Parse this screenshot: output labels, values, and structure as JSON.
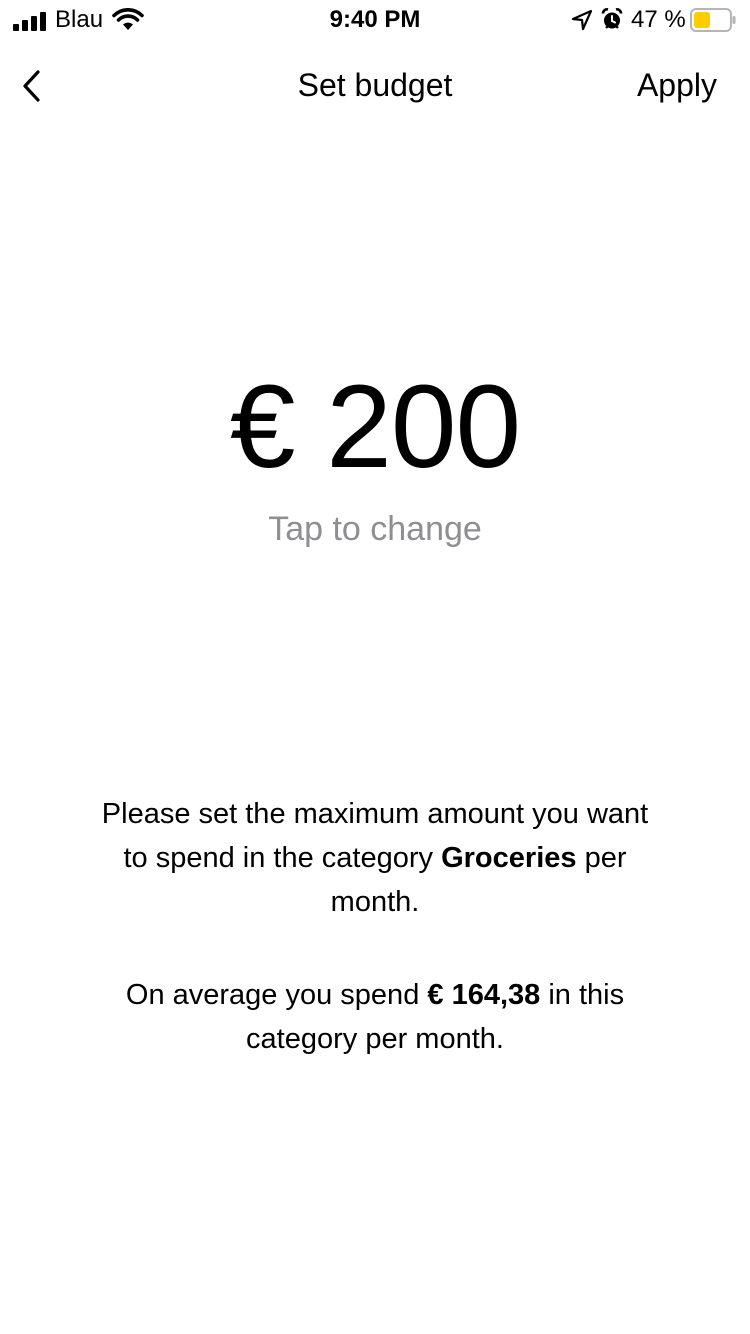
{
  "status_bar": {
    "carrier": "Blau",
    "time": "9:40 PM",
    "battery_percent": "47 %",
    "battery_level": 0.47,
    "battery_color": "#ffcc00",
    "icons": [
      "signal-icon",
      "wifi-icon",
      "location-icon",
      "alarm-icon",
      "battery-icon"
    ]
  },
  "nav": {
    "back_icon": "chevron-left-icon",
    "title": "Set budget",
    "apply_label": "Apply"
  },
  "budget": {
    "amount_display": "€ 200",
    "tap_hint": "Tap to change"
  },
  "description": {
    "line1_prefix": "Please set the maximum amount you want to spend in the category",
    "category": "Groceries",
    "line1_suffix": "per month.",
    "line2_prefix": "On average you spend",
    "average_amount": "€ 164,38",
    "line2_suffix": "in this category per month."
  },
  "colors": {
    "text": "#000000",
    "hint": "#8e8e93",
    "background": "#ffffff"
  }
}
